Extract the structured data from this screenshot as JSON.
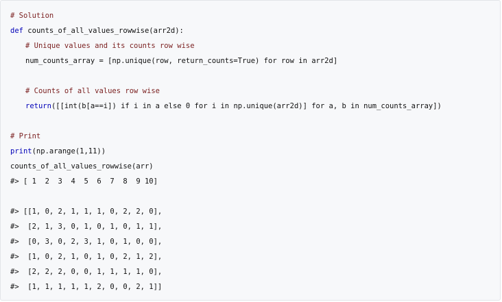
{
  "code": {
    "lines": [
      {
        "kind": "comment",
        "text": "# Solution"
      },
      {
        "kind": "keyword-line",
        "kw": "def ",
        "rest": "counts_of_all_values_rowwise(arr2d):"
      },
      {
        "kind": "comment",
        "indent": true,
        "text": "# Unique values and its counts row wise"
      },
      {
        "kind": "normal",
        "indent": true,
        "text": "num_counts_array = [np.unique(row, return_counts=True) for row in arr2d]"
      },
      {
        "kind": "blank",
        "text": ""
      },
      {
        "kind": "comment",
        "indent": true,
        "text": "# Counts of all values row wise"
      },
      {
        "kind": "keyword-line",
        "indent": true,
        "kw": "return",
        "rest": "([[int(b[a==i]) if i in a else 0 for i in np.unique(arr2d)] for a, b in num_counts_array])"
      },
      {
        "kind": "blank",
        "text": ""
      },
      {
        "kind": "comment",
        "text": "# Print"
      },
      {
        "kind": "keyword-line",
        "kw": "print",
        "rest": "(np.arange(1,11))"
      },
      {
        "kind": "normal",
        "text": "counts_of_all_values_rowwise(arr)"
      },
      {
        "kind": "output",
        "text": "#> [ 1  2  3  4  5  6  7  8  9 10]"
      },
      {
        "kind": "blank",
        "text": ""
      },
      {
        "kind": "output",
        "text": "#> [[1, 0, 2, 1, 1, 1, 0, 2, 2, 0],"
      },
      {
        "kind": "output",
        "text": "#>  [2, 1, 3, 0, 1, 0, 1, 0, 1, 1],"
      },
      {
        "kind": "output",
        "text": "#>  [0, 3, 0, 2, 3, 1, 0, 1, 0, 0],"
      },
      {
        "kind": "output",
        "text": "#>  [1, 0, 2, 1, 0, 1, 0, 2, 1, 2],"
      },
      {
        "kind": "output",
        "text": "#>  [2, 2, 2, 0, 0, 1, 1, 1, 1, 0],"
      },
      {
        "kind": "output",
        "text": "#>  [1, 1, 1, 1, 1, 2, 0, 0, 2, 1]]"
      }
    ]
  },
  "colors": {
    "comment": "#7a1f1f",
    "keyword": "#0000b8",
    "text": "#111111",
    "background": "#f7f8fa"
  }
}
